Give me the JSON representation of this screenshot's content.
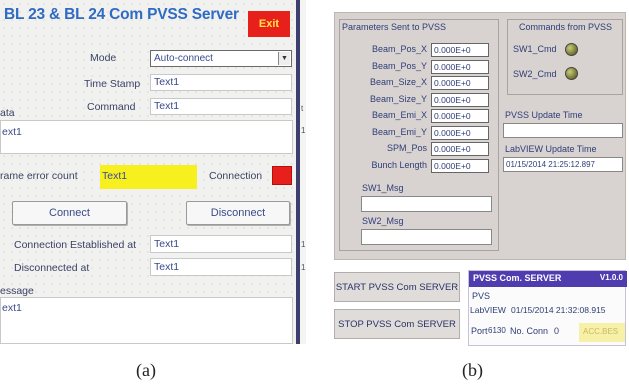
{
  "panel_a": {
    "title": "BL 23 & BL 24 Com PVSS Server",
    "exit_label": "Exit",
    "mode_label": "Mode",
    "mode_value": "Auto-connect",
    "time_stamp_label": "Time Stamp",
    "time_stamp_value": "Text1",
    "data_label": "ata",
    "command_label": "Command",
    "command_value": "Text1",
    "data_value": "ext1",
    "frame_error_label": "rame error count",
    "frame_error_value": "Text1",
    "connection_label": "Connection",
    "connect_button": "Connect",
    "disconnect_button": "Disconnect",
    "connection_established_label": "Connection Established at",
    "connection_established_value": "Text1",
    "disconnected_label": "Disconnected at",
    "disconnected_value": "Text1",
    "message_label": "essage",
    "message_value": "ext1",
    "edge_marks": [
      "t",
      "1",
      "1",
      "1"
    ]
  },
  "panel_b": {
    "params_title": "Parameters Sent to PVSS",
    "params": [
      {
        "label": "Beam_Pos_X",
        "value": "0.000E+0"
      },
      {
        "label": "Beam_Pos_Y",
        "value": "0.000E+0"
      },
      {
        "label": "Beam_Size_X",
        "value": "0.000E+0"
      },
      {
        "label": "Beam_Size_Y",
        "value": "0.000E+0"
      },
      {
        "label": "Beam_Emi_X",
        "value": "0.000E+0"
      },
      {
        "label": "Beam_Emi_Y",
        "value": "0.000E+0"
      },
      {
        "label": "SPM_Pos",
        "value": "0.000E+0"
      },
      {
        "label": "Bunch Length",
        "value": "0.000E+0"
      }
    ],
    "sw1_msg_label": "SW1_Msg",
    "sw2_msg_label": "SW2_Msg",
    "commands_title": "Commands from PVSS",
    "sw1_cmd_label": "SW1_Cmd",
    "sw2_cmd_label": "SW2_Cmd",
    "pvss_update_label": "PVSS Update Time",
    "pvss_update_value": "",
    "labview_update_label": "LabVIEW Update Time",
    "labview_update_value": "01/15/2014 21:25:12.897",
    "start_button": "START PVSS Com SERVER",
    "stop_button": "STOP PVSS Com SERVER",
    "server": {
      "title": "PVSS Com. SERVER",
      "version": "V1.0.0",
      "pvs_label": "PVS",
      "labview_label": "LabVIEW",
      "labview_time": "01/15/2014 21:32:08.915",
      "port_label": "Port",
      "port_value": "6130",
      "conn_label": "No. Conn",
      "conn_value": "0",
      "status_value": "ACC.BES"
    }
  },
  "captions": {
    "a": "(a)",
    "b": "(b)"
  },
  "colors": {
    "title_blue": "#2f6bc2",
    "exit_red": "#e8201b",
    "highlight_yellow": "#f7ef1e",
    "server_header": "#4f3db0"
  }
}
